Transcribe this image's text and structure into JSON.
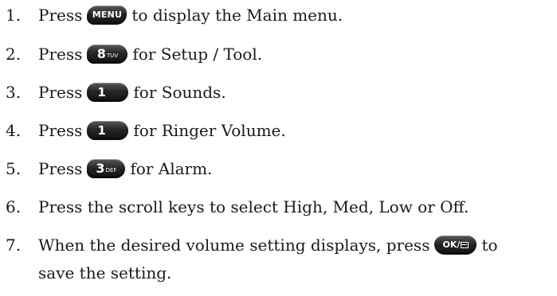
{
  "steps": [
    {
      "num": "1.",
      "before": "Press",
      "key": {
        "icon": "menu-key-icon",
        "label": "MENU",
        "sub": ""
      },
      "after": "to display the Main menu."
    },
    {
      "num": "2.",
      "before": "Press",
      "key": {
        "icon": "key-8-tuv-icon",
        "label": "8",
        "sub": "TUV"
      },
      "after": "for Setup / Tool."
    },
    {
      "num": "3.",
      "before": "Press",
      "key": {
        "icon": "key-1-icon",
        "label": "1",
        "sub": ""
      },
      "after": "for Sounds."
    },
    {
      "num": "4.",
      "before": "Press",
      "key": {
        "icon": "key-1-icon",
        "label": "1",
        "sub": ""
      },
      "after": "for Ringer Volume."
    },
    {
      "num": "5.",
      "before": "Press",
      "key": {
        "icon": "key-3-def-icon",
        "label": "3",
        "sub": "DEF"
      },
      "after": "for Alarm."
    },
    {
      "num": "6.",
      "text": "Press the scroll keys to select High, Med, Low or Off."
    },
    {
      "num": "7.",
      "before": "When the desired volume setting displays, press",
      "key": {
        "icon": "ok-mail-key-icon",
        "label": "OK/",
        "sub": ""
      },
      "after": "to",
      "after_line2": "save the setting."
    }
  ]
}
